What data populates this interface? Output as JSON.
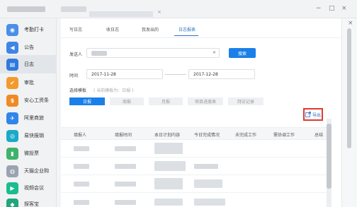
{
  "window": {
    "tab_close": "×",
    "minimize": "−",
    "maximize": "□",
    "close": "×",
    "side_close": "×"
  },
  "sidebar": {
    "items": [
      {
        "label": "考勤打卡",
        "icon": "location-icon",
        "glyph": "◉",
        "color": "#4a8fe8"
      },
      {
        "label": "公告",
        "icon": "megaphone-icon",
        "glyph": "◀",
        "color": "#3d86e6"
      },
      {
        "label": "日志",
        "icon": "log-icon",
        "glyph": "▤",
        "color": "#2e79dd"
      },
      {
        "label": "审批",
        "icon": "approval-icon",
        "glyph": "✔",
        "color": "#f39a2c"
      },
      {
        "label": "安心工资条",
        "icon": "salary-icon",
        "glyph": "$",
        "color": "#f08a24"
      },
      {
        "label": "阿里商旅",
        "icon": "travel-icon",
        "glyph": "✈",
        "color": "#2f86e8"
      },
      {
        "label": "易快报销",
        "icon": "expense-icon",
        "glyph": "◎",
        "color": "#1aa9c9"
      },
      {
        "label": "微投票",
        "icon": "vote-icon",
        "glyph": "▮",
        "color": "#3fb36a"
      },
      {
        "label": "天猫企业购",
        "icon": "tmall-icon",
        "glyph": "◍",
        "color": "#9aa3b0"
      },
      {
        "label": "视频会议",
        "icon": "video-icon",
        "glyph": "▶",
        "color": "#1bbc8f"
      },
      {
        "label": "探客宝",
        "icon": "explore-icon",
        "glyph": "◆",
        "color": "#22a57a"
      }
    ]
  },
  "tabs": [
    {
      "label": "写日志"
    },
    {
      "label": "收日志"
    },
    {
      "label": "我发出的"
    },
    {
      "label": "日志报表"
    }
  ],
  "filters": {
    "sender_label": "发送人",
    "sender_clear": "×",
    "search_button": "搜索",
    "time_label": "时间",
    "start_date": "2017-11-28",
    "end_date": "2017-12-28",
    "template_label": "选择模板",
    "template_hint": "( 当前模板为：日报 )",
    "templates": [
      "日报",
      "周报",
      "月报",
      "项目进度表",
      "拜访记录"
    ]
  },
  "export_label": "导出",
  "table": {
    "columns": [
      "填报人",
      "填报时间",
      "本日计划内容",
      "今日完成情况",
      "未完成工作",
      "需协调工作",
      "总结"
    ]
  },
  "colors": {
    "accent": "#1a7fe8",
    "highlight": "#e03a2f"
  }
}
